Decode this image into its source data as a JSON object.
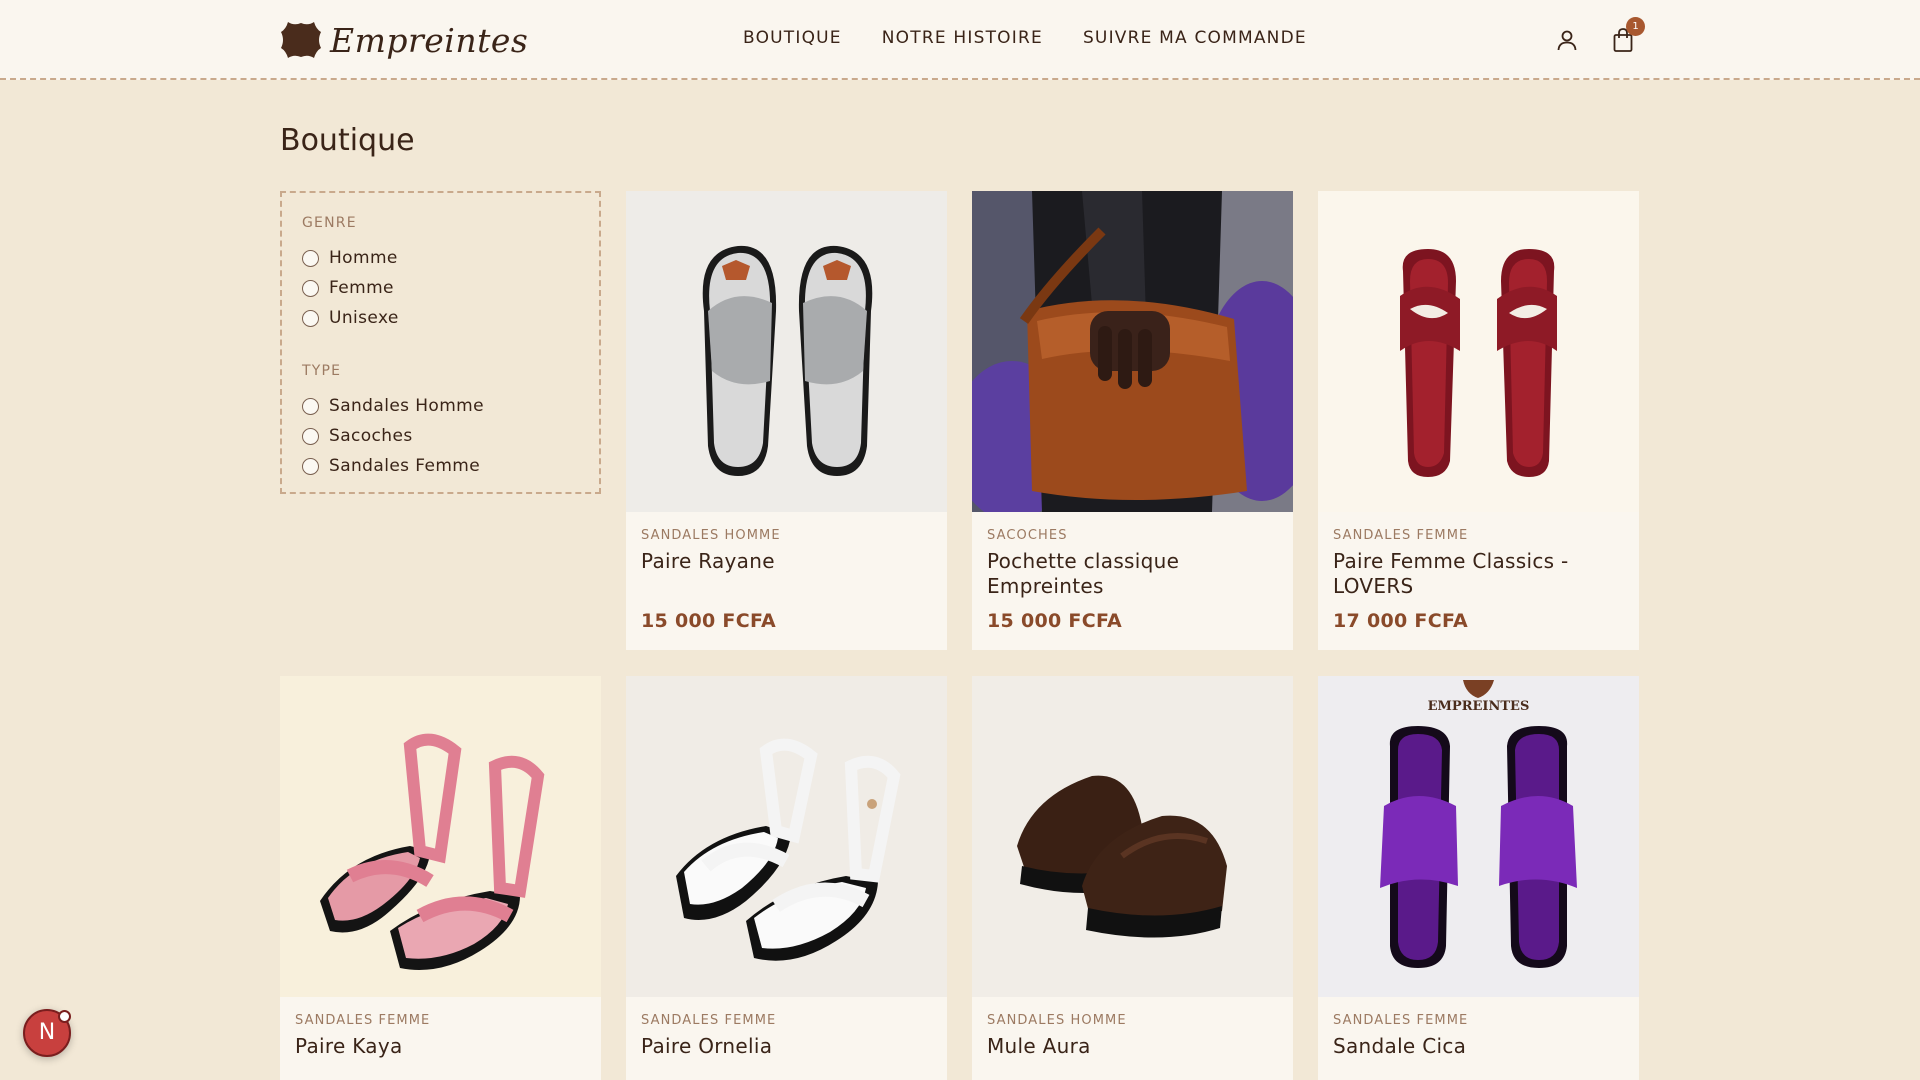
{
  "header": {
    "brand": "Empreintes",
    "nav": [
      "BOUTIQUE",
      "NOTRE HISTOIRE",
      "SUIVRE MA COMMANDE"
    ],
    "cart_count": "1"
  },
  "page": {
    "title": "Boutique"
  },
  "filters": {
    "genre": {
      "heading": "GENRE",
      "options": [
        "Homme",
        "Femme",
        "Unisexe"
      ]
    },
    "type": {
      "heading": "TYPE",
      "options": [
        "Sandales Homme",
        "Sacoches",
        "Sandales Femme"
      ]
    }
  },
  "products": [
    {
      "category": "SANDALES HOMME",
      "name": "Paire Rayane",
      "price": "15 000 FCFA"
    },
    {
      "category": "SACOCHES",
      "name": "Pochette classique Empreintes",
      "price": "15 000 FCFA"
    },
    {
      "category": "SANDALES FEMME",
      "name": "Paire Femme Classics - LOVERS",
      "price": "17 000 FCFA"
    },
    {
      "category": "SANDALES FEMME",
      "name": "Paire Kaya"
    },
    {
      "category": "SANDALES FEMME",
      "name": "Paire Ornelia"
    },
    {
      "category": "SANDALES HOMME",
      "name": "Mule Aura"
    },
    {
      "category": "SANDALES FEMME",
      "name": "Sandale Cica"
    }
  ],
  "image_text": {
    "cica_logo": "EMPREINTES"
  },
  "widget": {
    "letter": "N"
  },
  "colors": {
    "background": "#f2e8d6",
    "header_bg": "#faf6ef",
    "price": "#8a4a2a",
    "text": "#3a2418"
  }
}
